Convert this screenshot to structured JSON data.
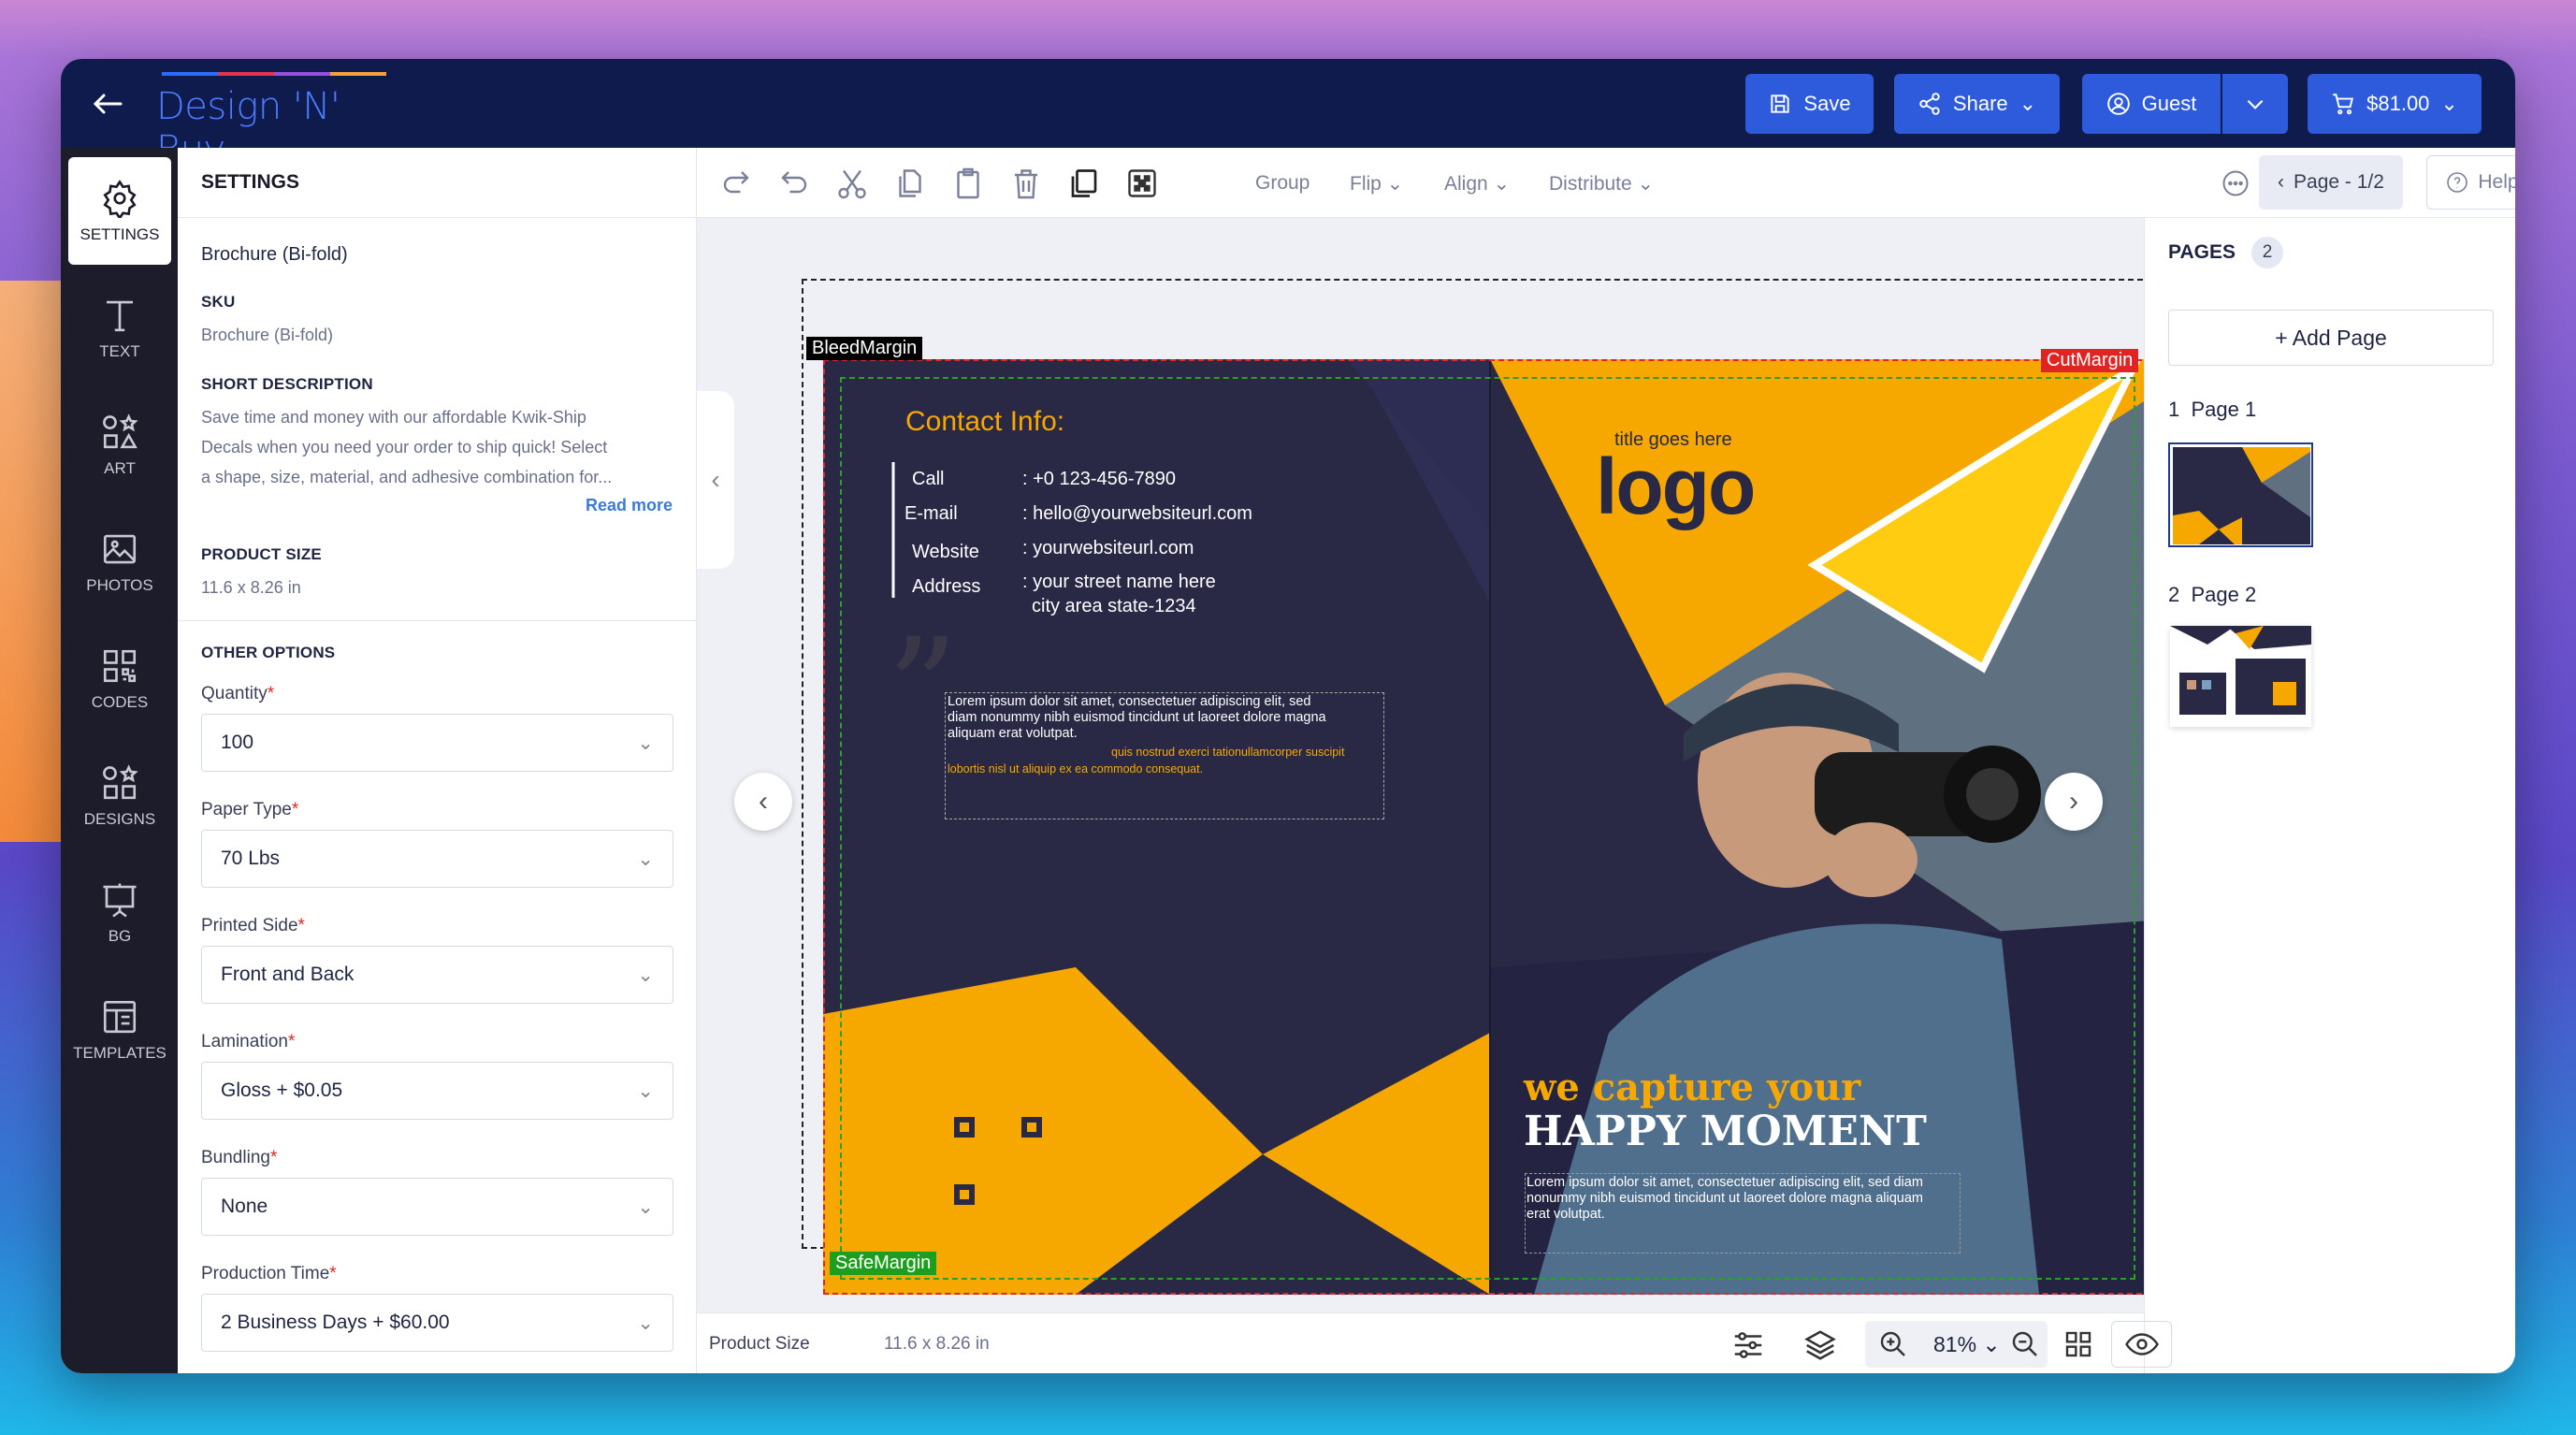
{
  "app": {
    "brand": "Design 'N' Buy",
    "save_label": "Save",
    "share_label": "Share",
    "guest_label": "Guest",
    "cart_label": "$81.00"
  },
  "sidebar": {
    "items": [
      {
        "label": "SETTINGS",
        "icon": "gear-icon"
      },
      {
        "label": "TEXT",
        "icon": "text-icon"
      },
      {
        "label": "ART",
        "icon": "shapes-icon"
      },
      {
        "label": "PHOTOS",
        "icon": "image-icon"
      },
      {
        "label": "CODES",
        "icon": "qr-icon"
      },
      {
        "label": "DESIGNS",
        "icon": "designs-icon"
      },
      {
        "label": "BG",
        "icon": "easel-icon"
      },
      {
        "label": "TEMPLATES",
        "icon": "templates-icon"
      }
    ]
  },
  "settings": {
    "title": "SETTINGS",
    "product_name": "Brochure (Bi-fold)",
    "sku_label": "SKU",
    "sku_value": "Brochure (Bi-fold)",
    "short_desc_label": "SHORT DESCRIPTION",
    "short_desc_l1": "Save time and money with our affordable Kwik-Ship",
    "short_desc_l2": "Decals when you need your order to ship quick! Select",
    "short_desc_l3": "a shape, size, material, and adhesive combination for...",
    "read_more": "Read more",
    "size_label": "PRODUCT SIZE",
    "size_value": "11.6 x 8.26 in",
    "other_label": "OTHER OPTIONS",
    "options": [
      {
        "label": "Quantity",
        "value": "100"
      },
      {
        "label": "Paper Type",
        "value": "70 Lbs"
      },
      {
        "label": "Printed Side",
        "value": "Front and Back"
      },
      {
        "label": "Lamination",
        "value": "Gloss + $0.05"
      },
      {
        "label": "Bundling",
        "value": "None"
      },
      {
        "label": "Production Time",
        "value": "2 Business Days + $60.00"
      }
    ]
  },
  "toolbar": {
    "group": "Group",
    "flip": "Flip",
    "align": "Align",
    "distribute": "Distribute",
    "page_indicator": "Page - 1/2",
    "help": "Help"
  },
  "canvas": {
    "bleed_tag": "BleedMargin",
    "cut_tag": "CutMargin",
    "safe_tag": "SafeMargin",
    "contact_title": "Contact Info:",
    "contacts": [
      {
        "k": "Call",
        "v": ": +0 123-456-7890"
      },
      {
        "k": "E-mail",
        "v": ": hello@yourwebsiteurl.com"
      },
      {
        "k": "Website",
        "v": ": yourwebsiteurl.com"
      },
      {
        "k": "Address",
        "v": ": your street name here"
      }
    ],
    "address_l2": "city area state-1234",
    "lorem1_l1": "Lorem ipsum dolor sit amet, consectetuer adipiscing elit, sed",
    "lorem1_l2": "diam nonummy nibh euismod tincidunt ut laoreet dolore magna",
    "lorem1_l3": "aliquam erat volutpat.",
    "lorem1_o1": "quis nostrud exerci tationullamcorper suscipit",
    "lorem1_o2": "lobortis nisl ut aliquip ex ea commodo consequat.",
    "title_small": "title goes here",
    "logo_text": "logo",
    "tagline1": "we capture your",
    "tagline2": "HAPPY MOMENT",
    "lorem2_l1": "Lorem ipsum dolor sit amet, consectetuer adipiscing elit, sed diam",
    "lorem2_l2": "nonummy nibh euismod tincidunt ut laoreet dolore magna aliquam",
    "lorem2_l3": "erat volutpat."
  },
  "pages": {
    "title": "PAGES",
    "count": "2",
    "add_page": "+ Add Page",
    "list": [
      {
        "num": "1",
        "label": "Page 1"
      },
      {
        "num": "2",
        "label": "Page 2"
      }
    ]
  },
  "bottom": {
    "size_label": "Product Size",
    "size_value": "11.6 x 8.26 in",
    "zoom": "81%"
  },
  "colors": {
    "navy": "#0f1b4c",
    "accent_blue": "#2d5bdc",
    "brochure_dark": "#2a2945",
    "brochure_orange": "#f6a800"
  }
}
